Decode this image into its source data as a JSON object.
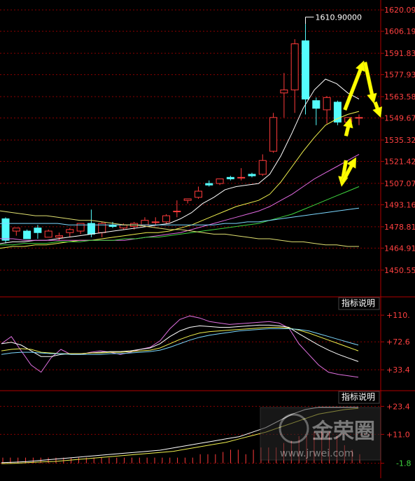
{
  "chart_data": [
    {
      "type": "candlestick",
      "panel": "price",
      "ylim": [
        1445,
        1622
      ],
      "y_tick_labels": [
        "1620.09",
        "1606.19",
        "1591.83",
        "1577.93",
        "1563.58",
        "1549.67",
        "1535.32",
        "1521.42",
        "1507.07",
        "1493.16",
        "1478.81",
        "1464.91",
        "1450.55"
      ],
      "y_tick_values": [
        1620.09,
        1606.19,
        1591.83,
        1577.93,
        1563.58,
        1549.67,
        1535.32,
        1521.42,
        1507.07,
        1493.16,
        1478.81,
        1464.91,
        1450.55
      ],
      "annotation": "1610.90000",
      "annotation_value": 1610.9,
      "up_color": "#ff3b3b",
      "down_color": "#54fcfc",
      "candles": [
        {
          "o": 1484,
          "h": 1485,
          "l": 1468,
          "c": 1470
        },
        {
          "o": 1476,
          "h": 1478,
          "l": 1473,
          "c": 1478
        },
        {
          "o": 1476,
          "h": 1477,
          "l": 1471,
          "c": 1471
        },
        {
          "o": 1478,
          "h": 1480,
          "l": 1471,
          "c": 1475
        },
        {
          "o": 1472,
          "h": 1477,
          "l": 1472,
          "c": 1476
        },
        {
          "o": 1472,
          "h": 1475,
          "l": 1470,
          "c": 1473
        },
        {
          "o": 1475,
          "h": 1478,
          "l": 1472,
          "c": 1477
        },
        {
          "o": 1476,
          "h": 1481,
          "l": 1474,
          "c": 1481
        },
        {
          "o": 1481,
          "h": 1490,
          "l": 1472,
          "c": 1474
        },
        {
          "o": 1475,
          "h": 1482,
          "l": 1472,
          "c": 1481
        },
        {
          "o": 1480,
          "h": 1482,
          "l": 1478,
          "c": 1479
        },
        {
          "o": 1478,
          "h": 1481,
          "l": 1477,
          "c": 1480
        },
        {
          "o": 1479,
          "h": 1482,
          "l": 1477,
          "c": 1481
        },
        {
          "o": 1480,
          "h": 1485,
          "l": 1479,
          "c": 1483
        },
        {
          "o": 1482,
          "h": 1485,
          "l": 1480,
          "c": 1482
        },
        {
          "o": 1482,
          "h": 1487,
          "l": 1481,
          "c": 1486
        },
        {
          "o": 1489,
          "h": 1496,
          "l": 1485,
          "c": 1489
        },
        {
          "o": 1496,
          "h": 1497,
          "l": 1494,
          "c": 1497
        },
        {
          "o": 1498,
          "h": 1505,
          "l": 1497,
          "c": 1502
        },
        {
          "o": 1507,
          "h": 1509,
          "l": 1505,
          "c": 1506
        },
        {
          "o": 1507,
          "h": 1510,
          "l": 1506,
          "c": 1510
        },
        {
          "o": 1511,
          "h": 1512,
          "l": 1509,
          "c": 1510
        },
        {
          "o": 1511,
          "h": 1517,
          "l": 1509,
          "c": 1511
        },
        {
          "o": 1513,
          "h": 1514,
          "l": 1511,
          "c": 1512
        },
        {
          "o": 1513,
          "h": 1526,
          "l": 1512,
          "c": 1522
        },
        {
          "o": 1528,
          "h": 1553,
          "l": 1527,
          "c": 1550
        },
        {
          "o": 1566,
          "h": 1579,
          "l": 1550,
          "c": 1568
        },
        {
          "o": 1568,
          "h": 1601,
          "l": 1553,
          "c": 1598
        },
        {
          "o": 1600,
          "h": 1610.9,
          "l": 1552,
          "c": 1562
        },
        {
          "o": 1561,
          "h": 1563,
          "l": 1545,
          "c": 1556
        },
        {
          "o": 1555,
          "h": 1564,
          "l": 1546,
          "c": 1563
        },
        {
          "o": 1560,
          "h": 1561,
          "l": 1545,
          "c": 1547
        },
        {
          "o": 1547,
          "h": 1550,
          "l": 1539,
          "c": 1550
        },
        {
          "o": 1550,
          "h": 1552,
          "l": 1545,
          "c": 1550
        }
      ],
      "moving_averages": [
        {
          "color": "#ffffff",
          "values": [
            1467,
            1468,
            1469,
            1469,
            1470,
            1470,
            1471,
            1472,
            1473,
            1474,
            1475,
            1476,
            1477,
            1478,
            1479,
            1480,
            1481,
            1484,
            1488,
            1494,
            1498,
            1503,
            1505,
            1506,
            1507,
            1513,
            1525,
            1540,
            1556,
            1568,
            1575,
            1572,
            1566,
            1562
          ]
        },
        {
          "color": "#f0f04e",
          "values": [
            1464,
            1465,
            1466,
            1466,
            1467,
            1467,
            1468,
            1469,
            1470,
            1470,
            1471,
            1472,
            1473,
            1474,
            1475,
            1475,
            1476,
            1478,
            1480,
            1483,
            1486,
            1489,
            1492,
            1494,
            1496,
            1500,
            1508,
            1518,
            1528,
            1537,
            1545,
            1549,
            1552,
            1554
          ]
        },
        {
          "color": "#e26ae2",
          "values": [
            1472,
            1471,
            1471,
            1470,
            1470,
            1470,
            1470,
            1470,
            1470,
            1470,
            1470,
            1470,
            1470,
            1471,
            1472,
            1473,
            1474,
            1475,
            1477,
            1479,
            1481,
            1483,
            1485,
            1487,
            1489,
            1492,
            1496,
            1500,
            1505,
            1510,
            1514,
            1518,
            1522,
            1526
          ]
        },
        {
          "color": "#3fd63f",
          "values": [
            1467,
            1467,
            1467,
            1468,
            1468,
            1468,
            1469,
            1469,
            1469,
            1470,
            1470,
            1470,
            1471,
            1471,
            1472,
            1472,
            1473,
            1474,
            1475,
            1476,
            1477,
            1478,
            1479,
            1480,
            1481,
            1483,
            1485,
            1487,
            1490,
            1493,
            1496,
            1499,
            1502,
            1505
          ]
        },
        {
          "color": "#7cd8ff",
          "values": [
            1480,
            1481,
            1481,
            1481,
            1481,
            1481,
            1481,
            1480,
            1480,
            1480,
            1480,
            1480,
            1480,
            1480,
            1480,
            1480,
            1480,
            1480,
            1480,
            1480,
            1480,
            1481,
            1481,
            1482,
            1482,
            1483,
            1484,
            1485,
            1486,
            1487,
            1488,
            1489,
            1490,
            1491
          ]
        },
        {
          "color": "#e0e070",
          "values": [
            1490,
            1489,
            1488,
            1487,
            1486,
            1486,
            1485,
            1484,
            1483,
            1483,
            1482,
            1481,
            1480,
            1480,
            1479,
            1478,
            1477,
            1477,
            1476,
            1475,
            1474,
            1474,
            1473,
            1472,
            1471,
            1471,
            1470,
            1469,
            1469,
            1468,
            1467,
            1467,
            1466,
            1466
          ]
        }
      ],
      "forecast_arrows": [
        {
          "from": [
            1548,
            1555
          ],
          "to": [
            1565,
            1587
          ]
        },
        {
          "from": [
            1566,
            1586
          ],
          "to": [
            1574,
            1559
          ]
        },
        {
          "from": [
            1575,
            1560
          ],
          "to": [
            1580,
            1550
          ]
        },
        {
          "from": [
            1549,
            1538
          ],
          "to": [
            1553,
            1550
          ]
        },
        {
          "from": [
            1549,
            1522
          ],
          "to": [
            1545,
            1505
          ]
        },
        {
          "from": [
            1546,
            1508
          ],
          "to": [
            1558,
            1524
          ]
        }
      ]
    },
    {
      "type": "line",
      "panel": "indicator-1",
      "label": "指标说明",
      "ylim": [
        10,
        118
      ],
      "y_tick_labels": [
        "+110.",
        "+72.6",
        "+33.4"
      ],
      "y_tick_values": [
        110,
        72.6,
        33.4
      ],
      "series": [
        {
          "color": "#e070e0",
          "values": [
            70,
            80,
            60,
            40,
            30,
            50,
            62,
            55,
            55,
            58,
            60,
            58,
            55,
            58,
            62,
            65,
            74,
            91,
            104,
            109,
            106,
            101,
            99,
            97,
            98,
            99,
            100,
            101,
            99,
            92,
            70,
            55,
            40,
            30,
            27,
            25,
            23
          ]
        },
        {
          "color": "#ffffff",
          "values": [
            70,
            72,
            68,
            60,
            52,
            52,
            55,
            56,
            56,
            57,
            58,
            59,
            59,
            60,
            62,
            64,
            70,
            80,
            88,
            93,
            95,
            94,
            93,
            93,
            94,
            95,
            96,
            96,
            95,
            93,
            84,
            76,
            68,
            61,
            55,
            50,
            45
          ]
        },
        {
          "color": "#f0f04e",
          "values": [
            60,
            62,
            63,
            62,
            58,
            57,
            56,
            56,
            56,
            57,
            57,
            58,
            58,
            59,
            60,
            61,
            64,
            70,
            76,
            81,
            85,
            87,
            88,
            89,
            90,
            91,
            92,
            93,
            93,
            92,
            89,
            85,
            80,
            75,
            70,
            65,
            60
          ]
        },
        {
          "color": "#7cd8ff",
          "values": [
            55,
            57,
            58,
            58,
            57,
            56,
            56,
            55,
            55,
            55,
            55,
            56,
            56,
            57,
            58,
            59,
            61,
            65,
            70,
            75,
            79,
            82,
            84,
            86,
            88,
            89,
            90,
            91,
            91,
            91,
            90,
            88,
            84,
            80,
            76,
            72,
            68
          ]
        }
      ]
    },
    {
      "type": "bar-line",
      "panel": "indicator-2",
      "label": "指标说明",
      "ylim": [
        -5,
        26
      ],
      "y_tick_labels": [
        "+23.4",
        "+11.0",
        "-1.8"
      ],
      "y_tick_values": [
        23.4,
        11.0,
        -1.8
      ],
      "bars": [
        2.5,
        2.5,
        2.5,
        2.5,
        2.5,
        2.5,
        2.5,
        2.5,
        2.5,
        2.5,
        2.5,
        2.5,
        2.5,
        2.5,
        2.5,
        2.5,
        2.5,
        2.5,
        2.5,
        2.5,
        2.5,
        2.5,
        2.5,
        2.5,
        2.5,
        2.5,
        4,
        4,
        4,
        5,
        6,
        6,
        4,
        6,
        7,
        7,
        7,
        9,
        10,
        12,
        12,
        14,
        14,
        14,
        12,
        8,
        6,
        4
      ],
      "series": [
        {
          "color": "#ffffff",
          "values": [
            -1.5,
            -1.3,
            -1,
            -0.5,
            0,
            0.5,
            1,
            1.5,
            2,
            2.5,
            3,
            3.5,
            4,
            5,
            6,
            7,
            8,
            9,
            10,
            12,
            14,
            17,
            20,
            22,
            23,
            23,
            23,
            23
          ]
        },
        {
          "color": "#f0f04e",
          "values": [
            -2,
            -1.8,
            -1.5,
            -1.2,
            -1,
            -0.5,
            0,
            0.5,
            1,
            1.5,
            2,
            2.5,
            3,
            3.5,
            4.5,
            5.5,
            6.5,
            7.5,
            9,
            10.5,
            12,
            14,
            16,
            18,
            20,
            21,
            22,
            22.5
          ]
        }
      ]
    }
  ],
  "watermark": {
    "text": "金荣圈",
    "url": "www.jrwei.com"
  }
}
